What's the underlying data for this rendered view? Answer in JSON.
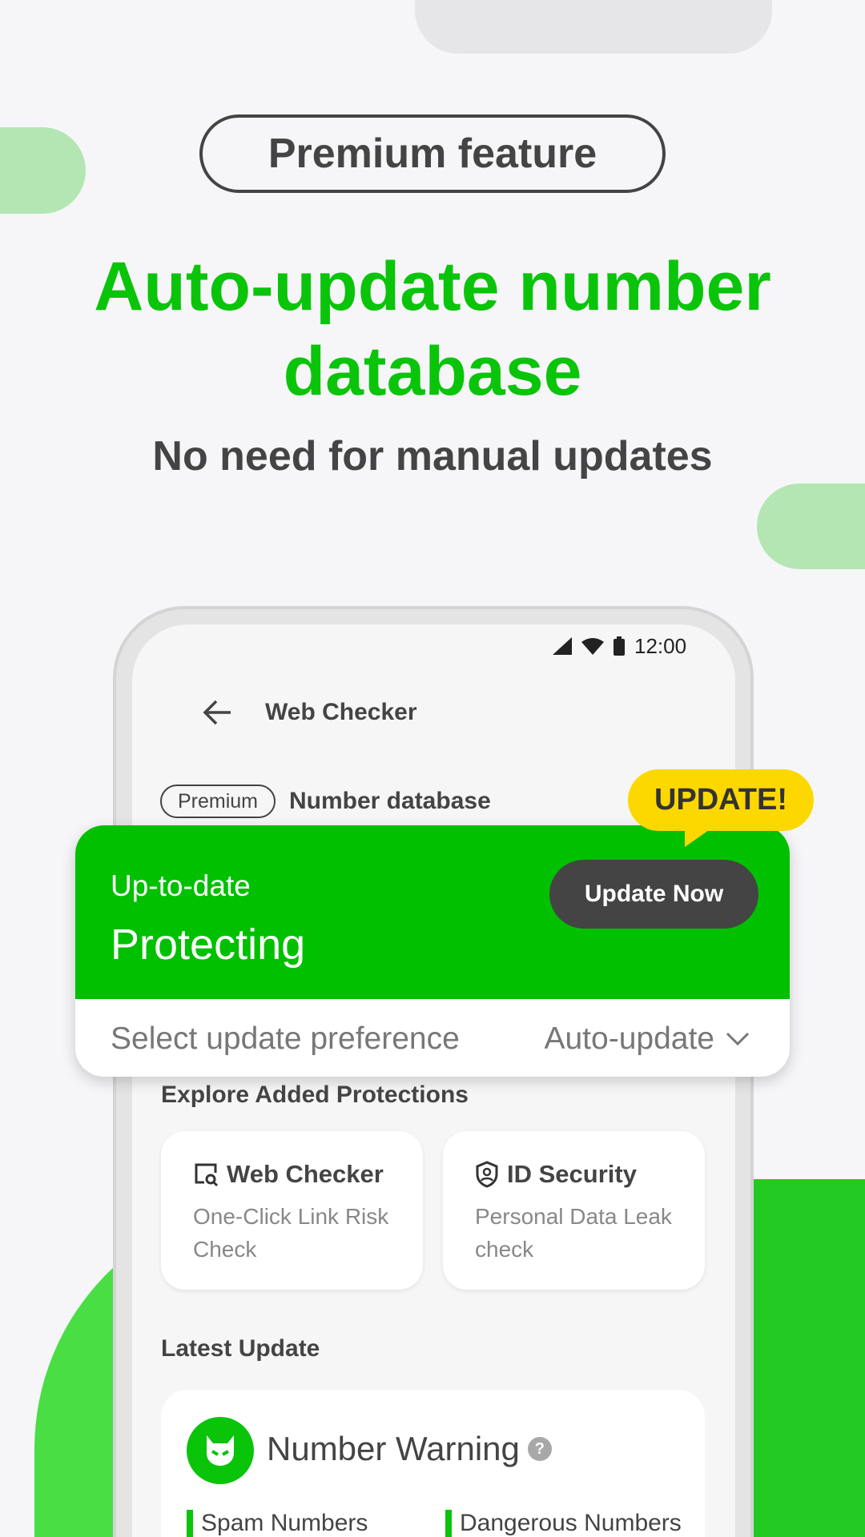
{
  "badge": "Premium feature",
  "headline": [
    "Auto-update number",
    "database"
  ],
  "subtitle": "No need for manual updates",
  "status_bar": {
    "time": "12:00"
  },
  "app_bar": {
    "title": "Web Checker"
  },
  "section": {
    "chip": "Premium",
    "label": "Number database"
  },
  "bubble": "UPDATE!",
  "status_card": {
    "status": "Up-to-date",
    "state": "Protecting",
    "button": "Update Now",
    "pref_label": "Select update preference",
    "pref_value": "Auto-update"
  },
  "explore": {
    "title": "Explore Added Protections",
    "cards": [
      {
        "title": "Web Checker",
        "desc": "One-Click Link Risk Check",
        "icon": "web-search-icon"
      },
      {
        "title": "ID Security",
        "desc": "Personal Data Leak check",
        "icon": "shield-user-icon"
      }
    ]
  },
  "latest": {
    "title": "Latest Update",
    "card_title": "Number Warning",
    "stats": [
      "Spam Numbers",
      "Dangerous Numbers"
    ]
  },
  "colors": {
    "brand_green": "#00c000",
    "headline_green": "#0ac40a",
    "bubble_yellow": "#fcd800",
    "dark_button": "#444444"
  }
}
